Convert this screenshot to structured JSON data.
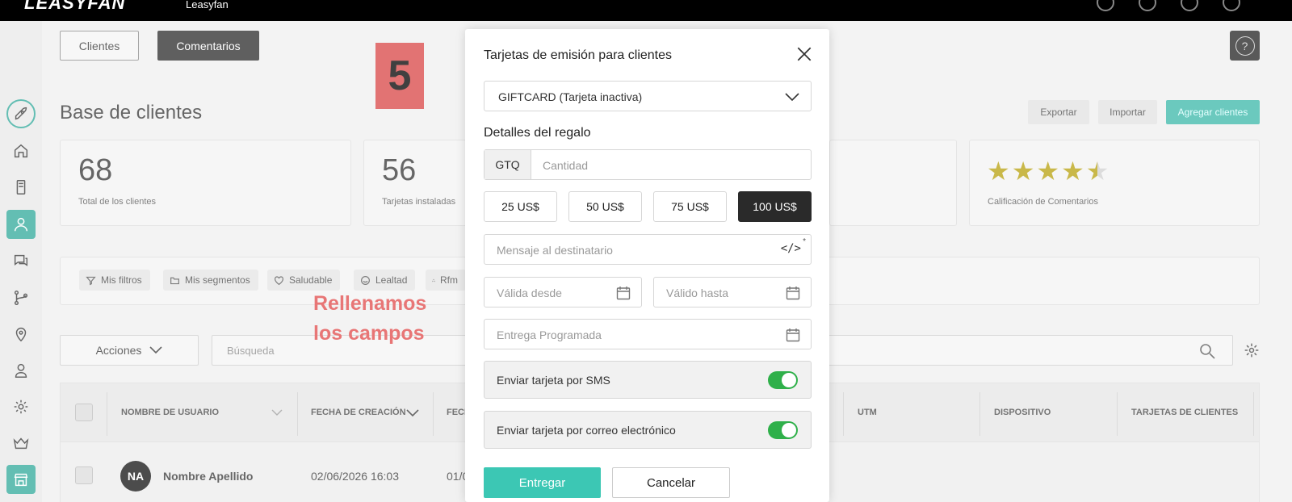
{
  "topbar": {
    "logo": "LEASYFAN",
    "brand": "Leasyfan"
  },
  "tabs": [
    {
      "label": "Clientes"
    },
    {
      "label": "Comentarios"
    }
  ],
  "page": {
    "title": "Base de clientes",
    "export_label": "Exportar",
    "import_label": "Importar",
    "add_label": "Agregar clientes",
    "help_icon": "?"
  },
  "stats": [
    {
      "value": "68",
      "label": "Total de los clientes"
    },
    {
      "value": "56",
      "label": "Tarjetas instaladas"
    },
    {
      "value": "",
      "label": "Calificación de Comentarios"
    }
  ],
  "rating": {
    "stars": 4.5,
    "max": 5
  },
  "filters": [
    "Mis filtros",
    "Mis segmentos",
    "Saludable",
    "Lealtad",
    "Rfm"
  ],
  "toolbar": {
    "actions_label": "Acciones",
    "search_placeholder": "Búsqueda"
  },
  "table": {
    "headers": [
      "NOMBRE DE USUARIO",
      "FECHA DE CREACIÓN",
      "FECH",
      "UTM",
      "DISPOSITIVO",
      "TARJETAS DE CLIENTES"
    ],
    "rows": [
      {
        "initials": "NA",
        "name": "Nombre Apellido",
        "created": "02/06/2026 16:03",
        "col3": "01/0"
      }
    ]
  },
  "annotation": {
    "step": "5",
    "note_line1": "Rellenamos",
    "note_line2": "los campos"
  },
  "modal": {
    "title": "Tarjetas de emisión para clientes",
    "card_select": "GIFTCARD (Tarjeta inactiva)",
    "section": "Detalles del regalo",
    "currency": "GTQ",
    "amount_placeholder": "Cantidad",
    "presets": [
      {
        "label": "25 US$",
        "selected": false
      },
      {
        "label": "50 US$",
        "selected": false
      },
      {
        "label": "75 US$",
        "selected": false
      },
      {
        "label": "100 US$",
        "selected": true
      }
    ],
    "message_placeholder": "Mensaje al destinatario",
    "code_icon": "</>",
    "code_mark": "*",
    "valid_from_placeholder": "Válida desde",
    "valid_to_placeholder": "Válido hasta",
    "scheduled_placeholder": "Entrega Programada",
    "sms_label": "Enviar tarjeta por SMS",
    "sms_on": true,
    "email_label": "Enviar tarjeta por correo electrónico",
    "email_on": true,
    "deliver_label": "Entregar",
    "cancel_label": "Cancelar"
  },
  "colors": {
    "accent": "#3cc7b4",
    "dark": "#2a2a2a",
    "toggle_on": "#2fb04a",
    "annotation": "#e04848"
  }
}
